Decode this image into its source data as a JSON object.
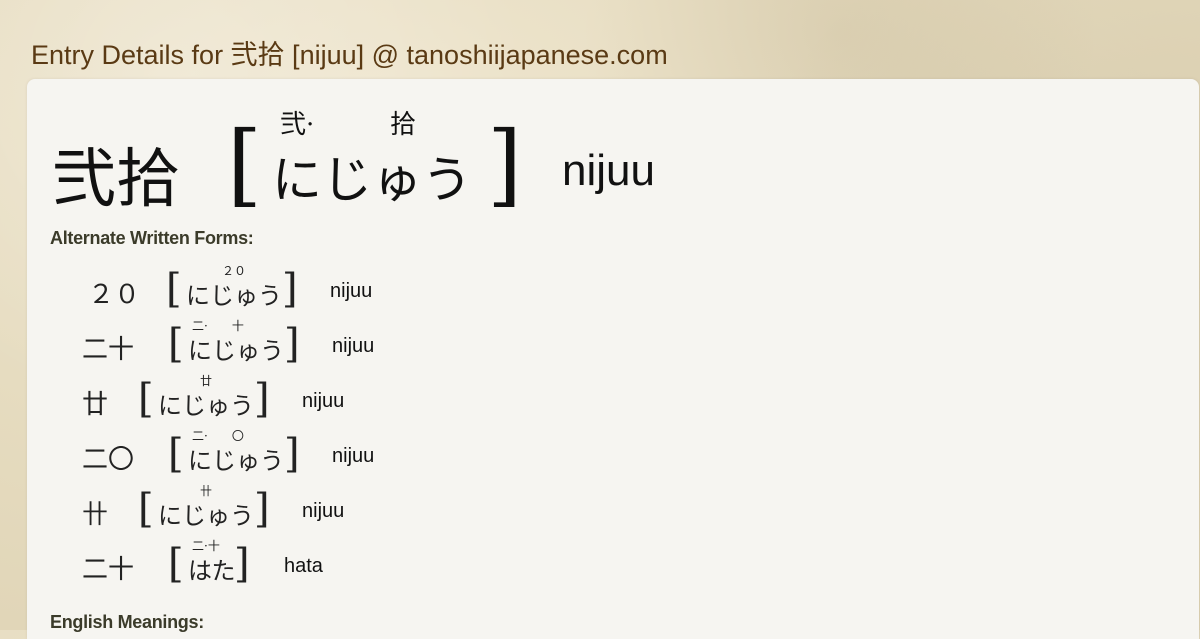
{
  "page": {
    "title": "Entry Details for 弐拾 [nijuu] @ tanoshiijapanese.com"
  },
  "entry": {
    "kanji": "弐拾",
    "kana": "にじゅう",
    "furigana_1": "弐·",
    "furigana_2": "拾",
    "romaji": "nijuu"
  },
  "sections": {
    "alternate_label": "Alternate Written Forms:",
    "meanings_label": "English Meanings:"
  },
  "alternate_forms": [
    {
      "kanji": "２０",
      "kana": "にじゅう",
      "furigana": "２０",
      "romaji": "nijuu"
    },
    {
      "kanji": "二十",
      "kana": "にじゅう",
      "furigana": "二·　　十",
      "romaji": "nijuu"
    },
    {
      "kanji": "廿",
      "kana": "にじゅう",
      "furigana": "廿",
      "romaji": "nijuu"
    },
    {
      "kanji": "二〇",
      "kana": "にじゅう",
      "furigana": "二·　　〇",
      "romaji": "nijuu"
    },
    {
      "kanji": "卄",
      "kana": "にじゅう",
      "furigana": "卄",
      "romaji": "nijuu"
    },
    {
      "kanji": "二十",
      "kana": "はた",
      "furigana": "二·十",
      "romaji": "hata"
    }
  ]
}
